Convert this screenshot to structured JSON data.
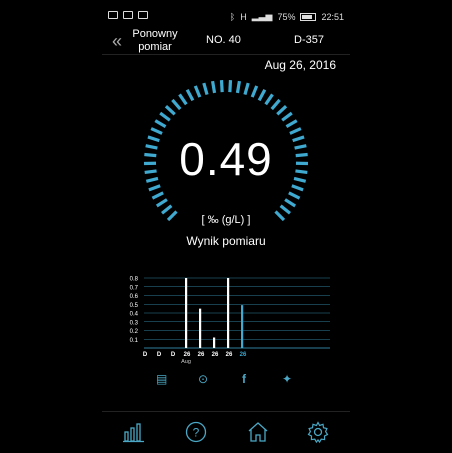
{
  "status_bar": {
    "battery": "75%",
    "time": "22:51",
    "network": "H"
  },
  "header": {
    "back_label": "Ponowny pomiar",
    "number": "NO. 40",
    "device_id": "D-357"
  },
  "date": "Aug 26, 2016",
  "reading": {
    "value": "0.49",
    "unit": "[ ‰ (g/L) ]",
    "label": "Wynik pomiaru"
  },
  "colors": {
    "accent": "#3fa9d0",
    "bar": "#ffffff",
    "gridline": "#3fa9d0"
  },
  "chart_data": {
    "type": "bar",
    "categories": [
      "D",
      "D",
      "D",
      "26",
      "26",
      "26",
      "26",
      "26"
    ],
    "sublabel": "Aug",
    "values": [
      0,
      0,
      0,
      0.8,
      0.45,
      0.12,
      0.8,
      0.49
    ],
    "highlight_index": 7,
    "ylim": [
      0,
      0.8
    ],
    "yticks": [
      "0.1",
      "0.2",
      "0.3",
      "0.4",
      "0.5",
      "0.6",
      "0.7",
      "0.8"
    ],
    "grid": true
  },
  "share_icons": [
    "notes-icon",
    "chat-icon",
    "facebook-icon",
    "twitter-icon"
  ],
  "nav": [
    "history-icon",
    "help-icon",
    "home-icon",
    "settings-icon"
  ]
}
